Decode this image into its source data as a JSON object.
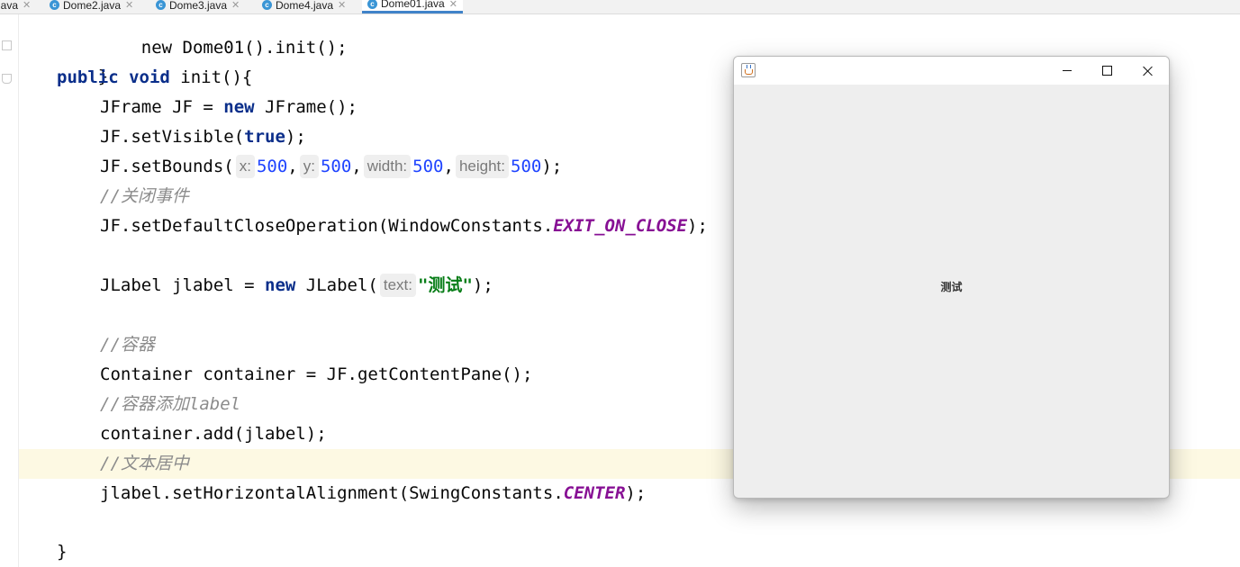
{
  "tabs": [
    {
      "label": "java",
      "icon": "none"
    },
    {
      "label": "Dome2.java",
      "icon": "class-icon"
    },
    {
      "label": "Dome3.java",
      "icon": "class-icon"
    },
    {
      "label": "Dome4.java",
      "icon": "class-icon"
    },
    {
      "label": "Dome01.java",
      "icon": "class-icon",
      "active": true
    }
  ],
  "code": {
    "l1": "new Dome01().init();",
    "l2": "}",
    "l3_kw1": "public",
    "l3_kw2": "void",
    "l3_rest": " init(){",
    "l4_a": "JFrame JF = ",
    "l4_kw": "new",
    "l4_b": " JFrame();",
    "l5_a": "JF.setVisible(",
    "l5_kw": "true",
    "l5_b": ");",
    "l6_a": "JF.setBounds(",
    "l6_hint_x": "x:",
    "l6_x": "500",
    "l6_hint_y": "y:",
    "l6_y": "500",
    "l6_hint_w": "width:",
    "l6_w": "500",
    "l6_hint_h": "height:",
    "l6_h": "500",
    "l6_end": ");",
    "c1": "//关闭事件",
    "l7_a": "JF.setDefaultCloseOperation(WindowConstants.",
    "l7_field": "EXIT_ON_CLOSE",
    "l7_b": ");",
    "l8_a": "JLabel jlabel = ",
    "l8_kw": "new",
    "l8_b": " JLabel(",
    "l8_hint": "text:",
    "l8_str": "\"测试\"",
    "l8_c": ");",
    "c2": "//容器",
    "l9": "Container container = JF.getContentPane();",
    "c3": "//容器添加label",
    "l10": "container.add(jlabel);",
    "c4": "//文本居中",
    "l11_a": "jlabel.setHorizontalAlignment(SwingConstants.",
    "l11_field": "CENTER",
    "l11_b": ");",
    "l12": "}"
  },
  "window": {
    "label_text": "测试",
    "icon": "java-cup-icon",
    "buttons": [
      "minimize-icon",
      "maximize-icon",
      "close-icon"
    ]
  },
  "colors": {
    "keyword": "#0a2e8a",
    "number": "#1f44ff",
    "string": "#077d17",
    "comment": "#8c8c8c",
    "static_field": "#871094",
    "current_line": "#fdf9e3",
    "tab_underline": "#4083c9"
  }
}
